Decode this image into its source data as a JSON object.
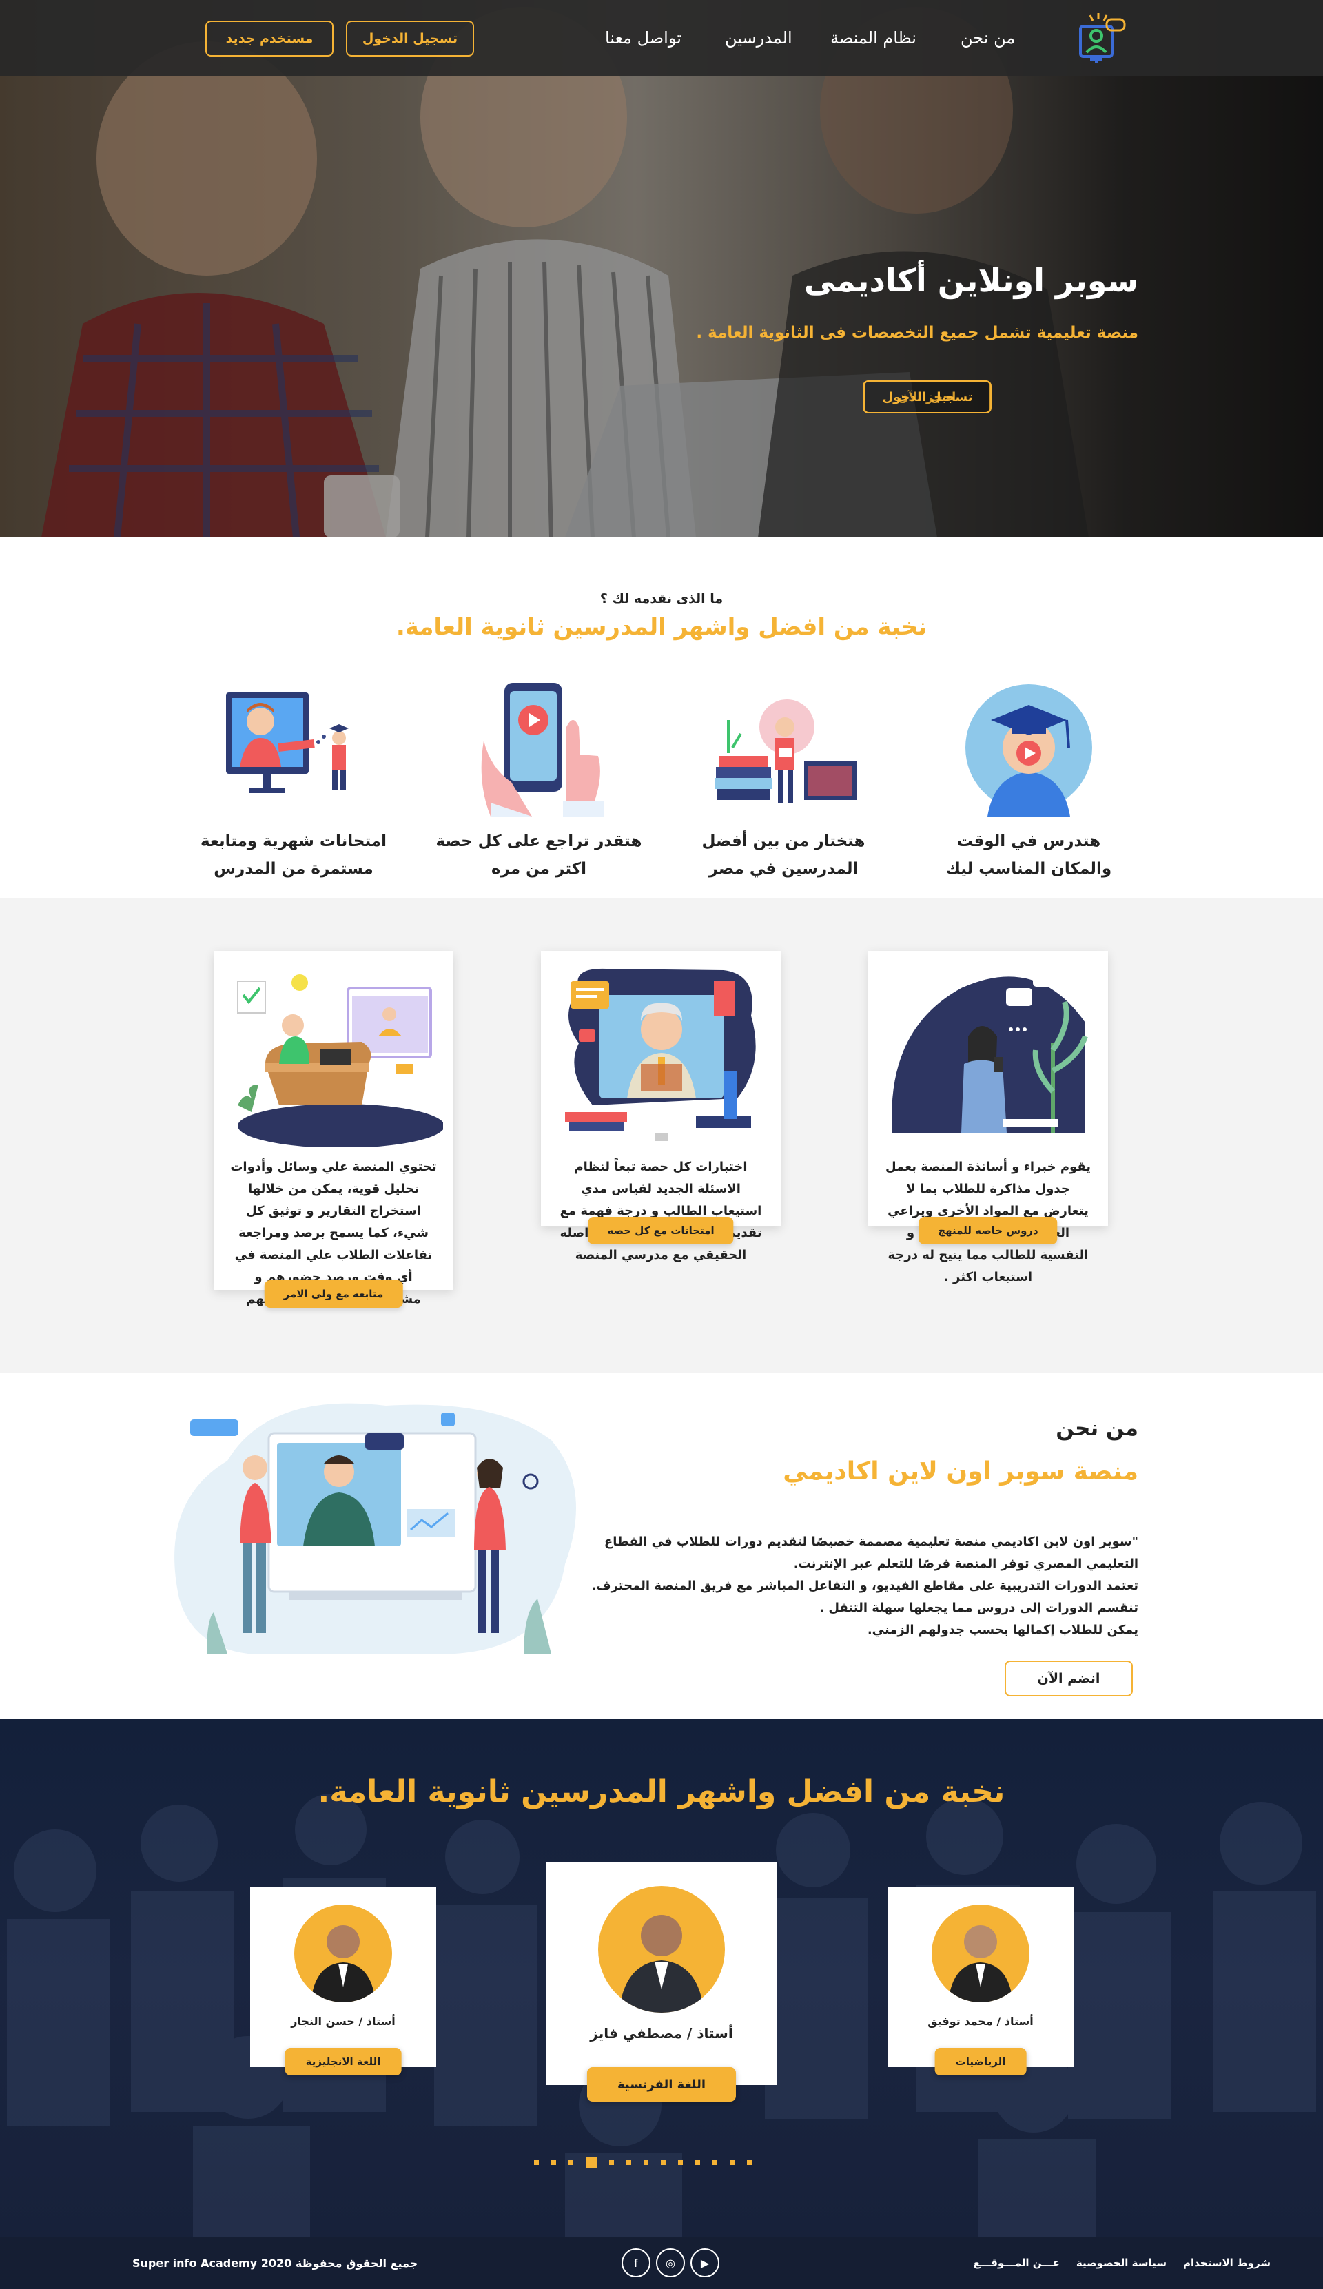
{
  "brand": {
    "accent": "#f5b335",
    "dark": "#151e33"
  },
  "header": {
    "nav": [
      "من نحن",
      "نظام المنصة",
      "المدرسين",
      "تواصل معنا"
    ],
    "login_button": "تسجيل الدخول",
    "register_button": "مستخدم جديد"
  },
  "hero": {
    "title": "سوبر اونلاين أكاديمى",
    "subtitle": "منصة تعليمية تشمل جميع التخصصات فى الثانوية العامة .",
    "book_button": "احجز الآن",
    "login_button": "تسجيل الدخول"
  },
  "offer": {
    "question": "ما الذى نقدمه لك ؟",
    "title": "نخبة من افضل واشهر المدرسين ثانوية العامة.",
    "features": [
      {
        "line1": "هتدرس في الوقت",
        "line2": "والمكان المناسب ليك",
        "icon": "graduate-video-icon"
      },
      {
        "line1": "هتختار من بين أفضل",
        "line2": "المدرسين في مصر",
        "icon": "teacher-books-icon"
      },
      {
        "line1": "هتقدر تراجع على كل حصة",
        "line2": "اكتر من مره",
        "icon": "phone-thumbs-up-icon"
      },
      {
        "line1": "امتحانات شهرية ومتابعة",
        "line2": "مستمرة من المدرس",
        "icon": "monitor-teacher-icon"
      }
    ]
  },
  "cards": [
    {
      "text": "يقوم خبراء و أساتذة المنصة بعمل جدول مذاكرة للطلاب بما لا يتعارض مع المواد الأخرى ويراعي العملية العلمية و التربوية و النفسية للطالب مما يتيح له درجة استيعاب اكثر .",
      "button": "دروس خاصه للمنهج"
    },
    {
      "text": "اختبارات كل حصة تبعاً لنظام الاسئلة الجديد لقياس مدي استيعاب الطالب و درجة فهمة مع تقديم النصح و الأرشاد له بتواصله الحقيقي مع مدرسي المنصة",
      "button": "امتحانات مع كل حصه"
    },
    {
      "text": "تحتوي المنصة علي وسائل وأدوات تحليل قوية، يمكن من خلالها استخراج التقارير و توثيق كل شيء، كما يسمح برصد ومراجعة تفاعلات الطلاب علي المنصة في أي وقت ورصد حضورهم و مشاهدتهم و درجة استيعابهم",
      "button": "متابعه مع ولى الامر"
    }
  ],
  "about": {
    "label": "من نحن",
    "title": "منصة سوبر اون لاين اكاديمي",
    "paragraphs": [
      "\"سوبر اون لاين اكاديمي منصة تعليمية مصممة خصيصًا لتقديم دورات للطلاب في القطاع التعليمي المصري توفر المنصة فرصًا للتعلم عبر الإنترنت.",
      "تعتمد الدورات التدريبية على مقاطع الفيديو، و التفاعل المباشر مع فريق المنصة المحترف.",
      "تنقسم الدورات إلى دروس مما يجعلها سهلة التنقل .",
      "يمكن للطلاب إكمالها بحسب جدولهم الزمني."
    ],
    "join_button": "انضم الآن"
  },
  "teachers": {
    "title": "نخبة من افضل واشهر المدرسين ثانوية العامة.",
    "items": [
      {
        "name": "أستاذ / محمد توفيق",
        "subject": "الرياضيات"
      },
      {
        "name": "أستاذ / مصطفي فايز",
        "subject": "اللغة الفرنسية"
      },
      {
        "name": "أستاذ / حسن النجار",
        "subject": "اللغة الانجليزية"
      }
    ],
    "pagination": {
      "total": 13,
      "active": 10
    }
  },
  "footer": {
    "links": [
      "شروط الاستخدام",
      "سياسة الخصوصية",
      "عـــن المـــوقـــع"
    ],
    "social": [
      "youtube-icon",
      "instagram-icon",
      "facebook-icon"
    ],
    "copyright": "جميع الحقوق محفوظة Super info Academy 2020"
  }
}
